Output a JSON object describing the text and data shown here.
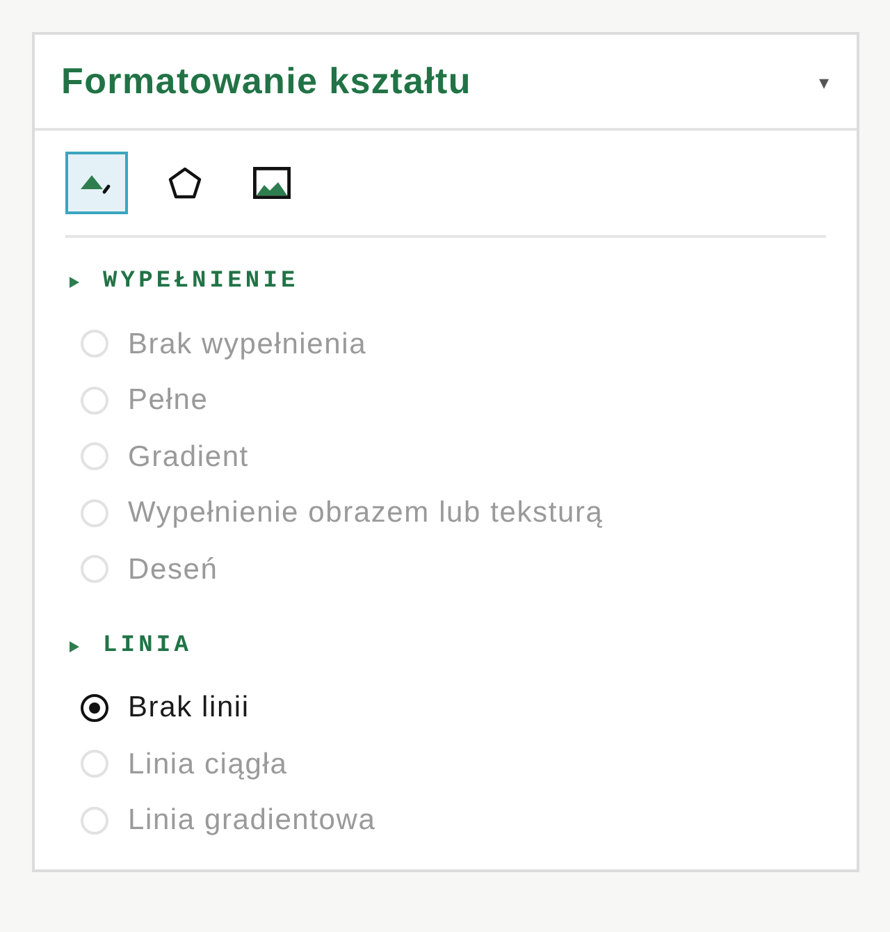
{
  "panel": {
    "title": "Formatowanie kształtu",
    "collapse_caret": "▾"
  },
  "tabs": [
    {
      "kind": "fill",
      "selected": true
    },
    {
      "kind": "shape",
      "selected": false
    },
    {
      "kind": "image",
      "selected": false
    }
  ],
  "sections": [
    {
      "title": "WYPEŁNIENIE",
      "options": [
        {
          "label": "Brak wypełnienia",
          "selected": false,
          "disabled": true
        },
        {
          "label": "Pełne",
          "selected": false,
          "disabled": true
        },
        {
          "label": "Gradient",
          "selected": false,
          "disabled": true
        },
        {
          "label": "Wypełnienie obrazem lub teksturą",
          "selected": false,
          "disabled": true
        },
        {
          "label": "Deseń",
          "selected": false,
          "disabled": true
        }
      ]
    },
    {
      "title": "LINIA",
      "options": [
        {
          "label": "Brak linii",
          "selected": true,
          "disabled": false
        },
        {
          "label": "Linia ciągła",
          "selected": false,
          "disabled": true
        },
        {
          "label": "Linia gradientowa",
          "selected": false,
          "disabled": true
        }
      ]
    }
  ]
}
